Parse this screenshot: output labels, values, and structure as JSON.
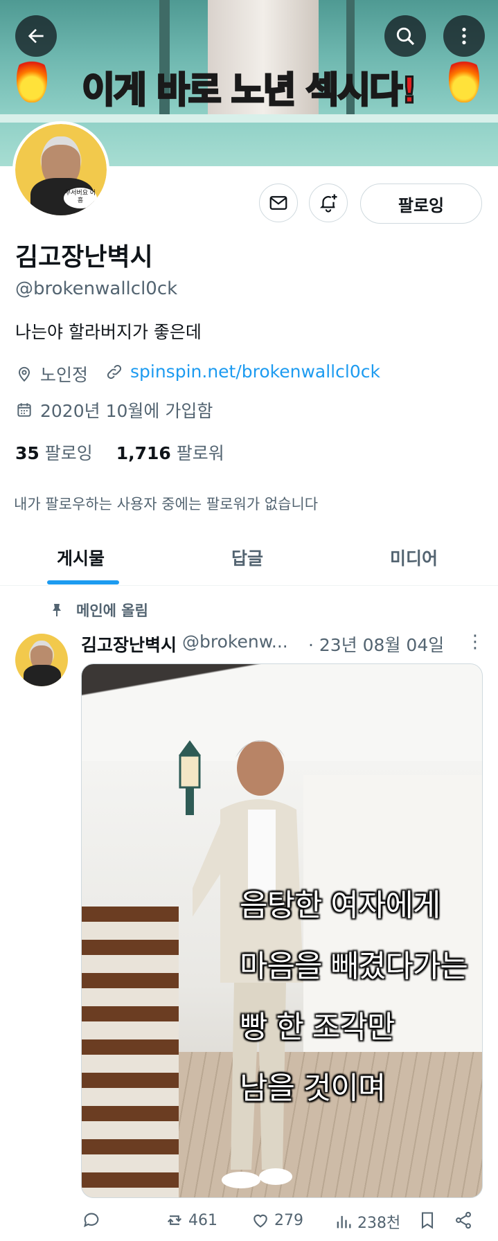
{
  "banner": {
    "title_part1": "이게 바로 ",
    "title_part2": "노년 섹시다!"
  },
  "header": {
    "back_icon": "arrow-left-icon",
    "search_icon": "search-icon",
    "more_icon": "more-vertical-icon"
  },
  "profile": {
    "avatar_bubble": "무서버요 어흥",
    "message_icon": "mail-icon",
    "notify_icon": "bell-plus-icon",
    "follow_label": "팔로잉",
    "display_name": "김고장난벽시",
    "handle": "@brokenwallcl0ck",
    "bio": "나는야 할라버지가 좋은데",
    "location": "노인정",
    "website": "spinspin.net/brokenwallcl0ck",
    "joined": "2020년 10월에 가입함",
    "following_count": "35",
    "following_label": "팔로잉",
    "followers_count": "1,716",
    "followers_label": "팔로워",
    "no_common_followers": "내가 팔로우하는 사용자 중에는 팔로워가 없습니다"
  },
  "tabs": [
    {
      "label": "게시물",
      "active": true
    },
    {
      "label": "답글",
      "active": false
    },
    {
      "label": "미디어",
      "active": false
    }
  ],
  "pinned_tweet": {
    "pinned_label": "메인에 올림",
    "author_name": "김고장난벽시",
    "author_handle": "@brokenw...",
    "date": "· 23년 08월 04일",
    "more": "⋮",
    "image_caption_lines": [
      "음탕한 여자에게",
      "마음을 빼겼다가는",
      "빵 한 조각만",
      "남을 것이며"
    ],
    "replies": "",
    "retweets": "461",
    "likes": "279",
    "views": "238천"
  },
  "colors": {
    "accent": "#1d9bf0",
    "text": "#0f1419",
    "secondary": "#536471",
    "border": "#cfd9de"
  }
}
